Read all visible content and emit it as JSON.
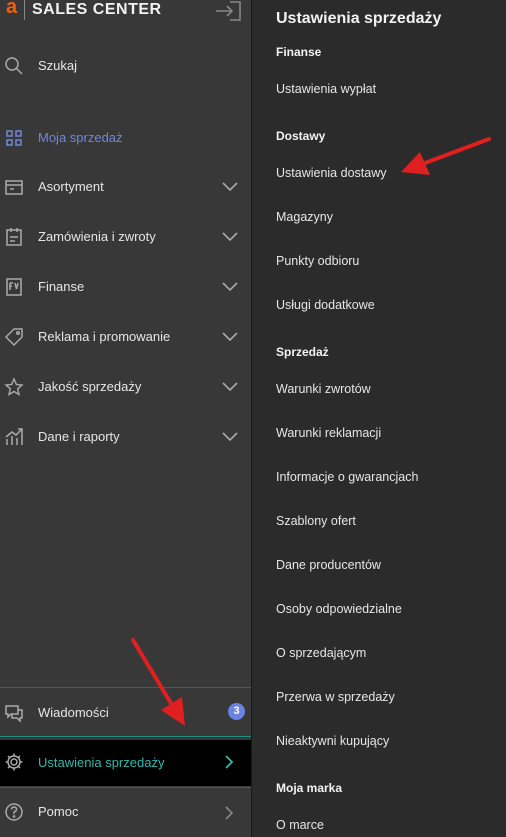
{
  "brand": {
    "logo": "a",
    "name": "SALES CENTER"
  },
  "sidebar": {
    "search": "Szukaj",
    "items": [
      {
        "label": "Moja sprzedaż"
      },
      {
        "label": "Asortyment"
      },
      {
        "label": "Zamówienia i zwroty"
      },
      {
        "label": "Finanse"
      },
      {
        "label": "Reklama i promowanie"
      },
      {
        "label": "Jakość sprzedaży"
      },
      {
        "label": "Dane i raporty"
      }
    ],
    "bottom": [
      {
        "label": "Wiadomości",
        "badge": "3"
      },
      {
        "label": "Ustawienia sprzedaży"
      },
      {
        "label": "Pomoc"
      }
    ]
  },
  "panel": {
    "title": "Ustawienia sprzedaży",
    "sections": [
      {
        "heading": "Finanse",
        "links": [
          "Ustawienia wypłat"
        ]
      },
      {
        "heading": "Dostawy",
        "links": [
          "Ustawienia dostawy",
          "Magazyny",
          "Punkty odbioru",
          "Usługi dodatkowe"
        ]
      },
      {
        "heading": "Sprzedaż",
        "links": [
          "Warunki zwrotów",
          "Warunki reklamacji",
          "Informacje o gwarancjach",
          "Szablony ofert",
          "Dane producentów",
          "Osoby odpowiedzialne",
          "O sprzedającym",
          "Przerwa w sprzedaży",
          "Nieaktywni kupujący"
        ]
      },
      {
        "heading": "Moja marka",
        "links": [
          "O marce"
        ]
      }
    ]
  },
  "colors": {
    "accent_blue": "#6f87d8",
    "accent_teal": "#2fb9ad",
    "brand_orange": "#ff5a00",
    "annotation_red": "#e02020"
  }
}
